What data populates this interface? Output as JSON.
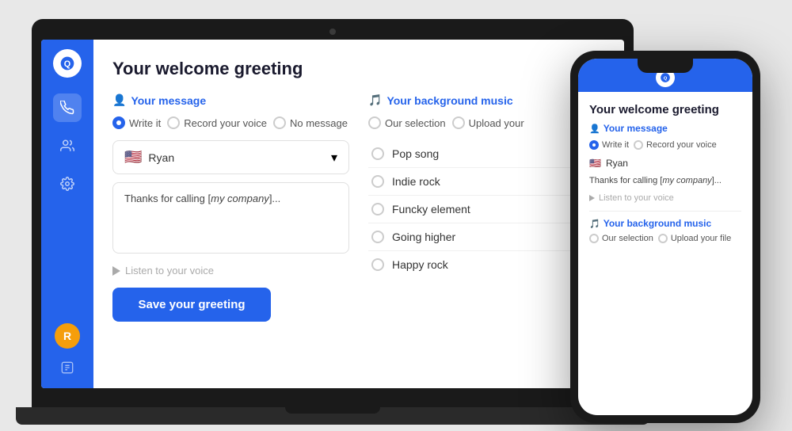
{
  "laptop": {
    "sidebar": {
      "logo_alt": "Q",
      "icons": [
        "phone-icon",
        "users-icon",
        "settings-icon"
      ]
    },
    "main": {
      "page_title": "Your welcome greeting",
      "your_message_label": "Your message",
      "message_icon": "👤",
      "music_icon": "🎵",
      "your_music_label": "Your background music",
      "radio_options": [
        {
          "label": "Write it",
          "value": "write_it",
          "selected": true
        },
        {
          "label": "Record your voice",
          "value": "record",
          "selected": false
        },
        {
          "label": "No message",
          "value": "no_message",
          "selected": false
        }
      ],
      "music_radio_options": [
        {
          "label": "Our selection",
          "value": "our_selection",
          "selected": false
        },
        {
          "label": "Upload your",
          "value": "upload",
          "selected": false
        }
      ],
      "voice_selector": {
        "flag": "🇺🇸",
        "name": "Ryan"
      },
      "message_text_prefix": "Thanks for calling [",
      "message_company": "my company",
      "message_text_suffix": "]...",
      "listen_label": "Listen to your voice",
      "save_button_label": "Save your greeting",
      "music_list": [
        {
          "label": "Pop song"
        },
        {
          "label": "Indie rock"
        },
        {
          "label": "Funcky element"
        },
        {
          "label": "Going higher"
        },
        {
          "label": "Happy rock"
        }
      ]
    }
  },
  "phone": {
    "title": "Your welcome greeting",
    "your_message_label": "Your message",
    "radio_options": [
      {
        "label": "Write it",
        "selected": true
      },
      {
        "label": "Record your voice",
        "selected": false
      }
    ],
    "voice_name": "Ryan",
    "message_text_prefix": "Thanks for calling [",
    "message_company": "my company",
    "message_text_suffix": "]...",
    "listen_label": "Listen to your voice",
    "music_label": "Your background music",
    "music_options": [
      {
        "label": "Our selection"
      },
      {
        "label": "Upload your file"
      }
    ]
  },
  "icons": {
    "phone": "📞",
    "users": "👥",
    "settings": "⚙️",
    "q_logo": "Q",
    "message": "👤",
    "music": "🎵",
    "chevron_down": "▾",
    "play": "▶"
  }
}
